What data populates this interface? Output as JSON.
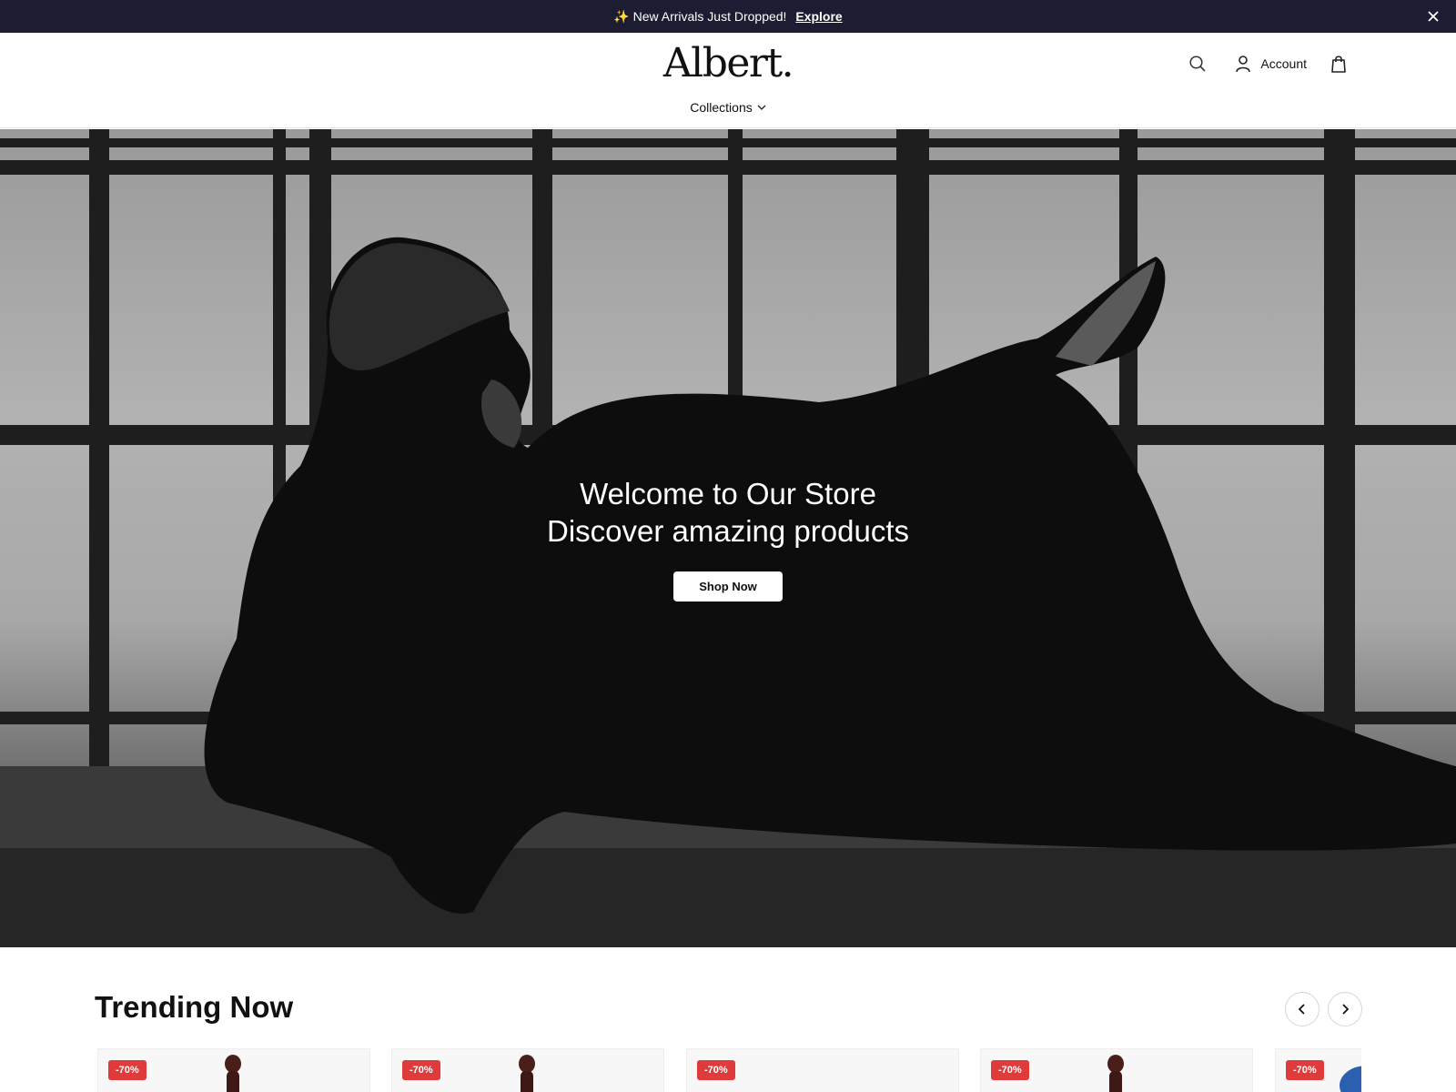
{
  "announcement": {
    "message": "✨ New Arrivals Just Dropped!",
    "link": "Explore",
    "close_icon": "close-icon"
  },
  "header": {
    "logo": "Albert.",
    "account_label": "Account",
    "icons": [
      "search-icon",
      "user-icon",
      "shopping-bag-icon"
    ],
    "nav": {
      "collections_label": "Collections",
      "dropdown_icon": "chevron-down-icon"
    }
  },
  "hero": {
    "line1": "Welcome to Our Store",
    "line2": "Discover amazing products",
    "cta_label": "Shop Now"
  },
  "trending": {
    "title": "Trending Now",
    "prev_icon": "chevron-left-icon",
    "next_icon": "chevron-right-icon",
    "products": [
      {
        "badge": "-70%"
      },
      {
        "badge": "-70%"
      },
      {
        "badge": "-70%"
      },
      {
        "badge": "-70%"
      },
      {
        "badge": "-70%"
      }
    ]
  },
  "colors": {
    "announcement_bg": "#1c1d33",
    "badge_bg": "#e03b3b",
    "text": "#111111"
  }
}
